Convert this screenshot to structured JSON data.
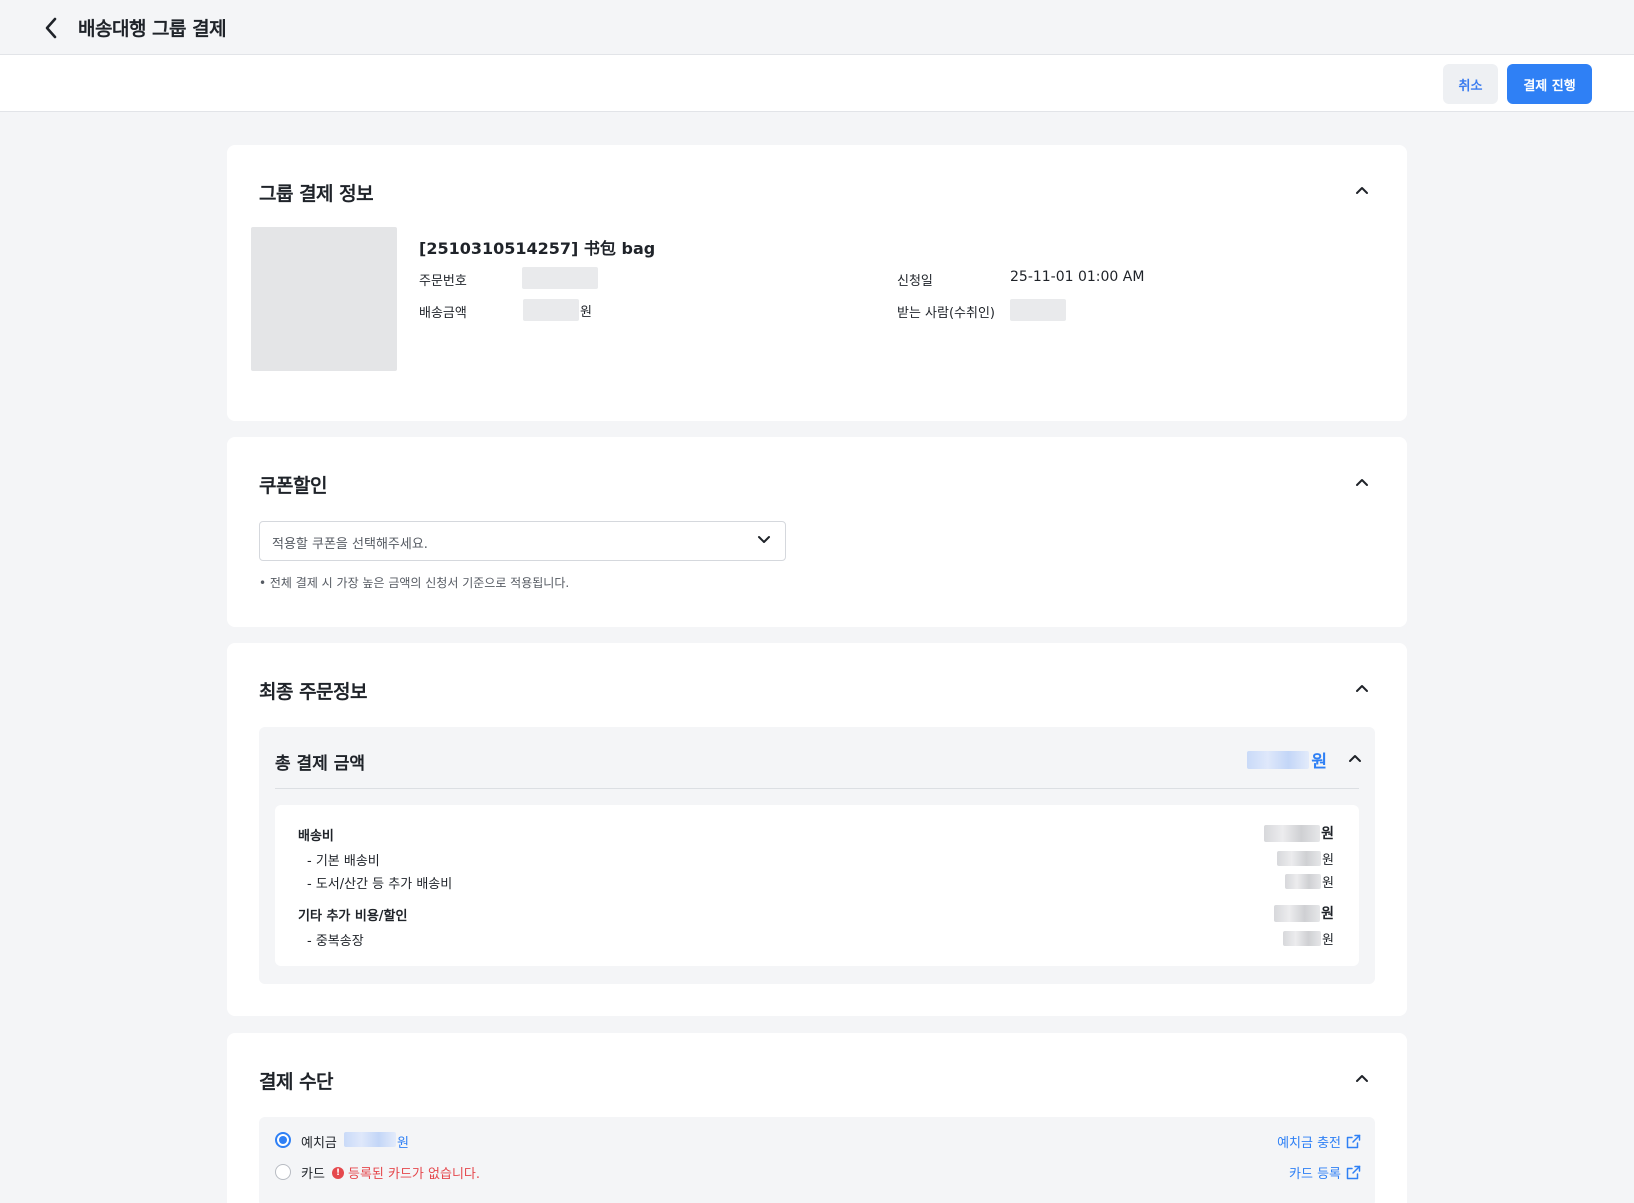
{
  "header": {
    "title": "배송대행 그룹 결제"
  },
  "actions": {
    "cancel_label": "취소",
    "pay_label": "결제 진행"
  },
  "group_info": {
    "title": "그룹 결제 정보",
    "item_title": "[2510310514257] 书包 bag",
    "order_no_label": "주문번호",
    "ship_amount_label": "배송금액",
    "currency_unit": "원",
    "apply_date_label": "신청일",
    "apply_date_value": "25-11-01 01:00 AM",
    "recipient_label": "받는 사람(수취인)"
  },
  "coupon": {
    "title": "쿠폰할인",
    "placeholder": "적용할 쿠폰을 선택해주세요.",
    "note": "• 전체 결제 시 가장 높은 금액의 신청서 기준으로 적용됩니다."
  },
  "final_order": {
    "title": "최종 주문정보",
    "total_label": "총 결제 금액",
    "currency_unit": "원",
    "rows": [
      {
        "label": "배송비"
      },
      {
        "label": "- 기본 배송비"
      },
      {
        "label": "- 도서/산간 등 추가 배송비"
      },
      {
        "label": "기타 추가 비용/할인"
      },
      {
        "label": "- 중복송장"
      }
    ]
  },
  "payment": {
    "title": "결제 수단",
    "deposit_label": "예치금",
    "currency_unit": "원",
    "card_label": "카드",
    "card_error": "등록된 카드가 없습니다.",
    "deposit_charge_link": "예치금 충전",
    "card_register_link": "카드 등록"
  },
  "colors": {
    "accent": "#2f80f5",
    "error": "#e5484d",
    "background": "#f4f5f7"
  },
  "icons": {
    "back": "chevron-left-icon",
    "collapse": "chevron-up-icon",
    "dropdown": "chevron-down-icon",
    "external": "external-link-icon",
    "error": "alert-circle-icon"
  }
}
